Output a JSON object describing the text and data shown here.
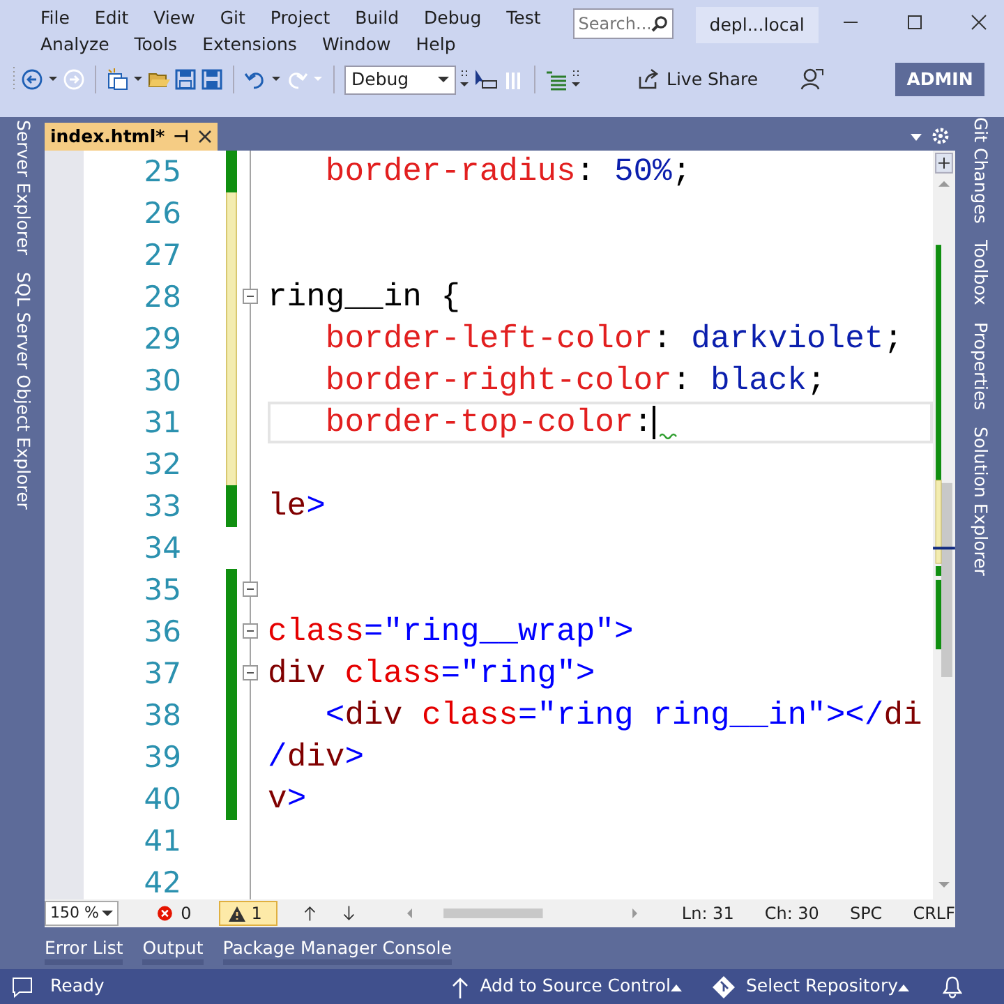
{
  "menu_rows": [
    [
      "File",
      "Edit",
      "View",
      "Git",
      "Project",
      "Build",
      "Debug",
      "Test"
    ],
    [
      "Analyze",
      "Tools",
      "Extensions",
      "Window",
      "Help"
    ]
  ],
  "search": {
    "placeholder": "Search..."
  },
  "solution_name": "depl...local",
  "toolbar": [
    {
      "kind": "back",
      "disabled": false
    },
    {
      "kind": "dropdown",
      "disabled": false
    },
    {
      "kind": "forward",
      "disabled": true
    },
    {
      "kind": "separator"
    },
    {
      "kind": "new",
      "disabled": false
    },
    {
      "kind": "dropdown",
      "disabled": false
    },
    {
      "kind": "open",
      "disabled": false
    },
    {
      "kind": "save",
      "disabled": false
    },
    {
      "kind": "save-all",
      "disabled": false
    },
    {
      "kind": "separator"
    },
    {
      "kind": "undo",
      "disabled": false
    },
    {
      "kind": "dropdown",
      "disabled": false
    },
    {
      "kind": "redo",
      "disabled": true
    },
    {
      "kind": "dropdown",
      "disabled": true
    },
    {
      "kind": "separator"
    },
    {
      "kind": "config"
    },
    {
      "kind": "overflow"
    },
    {
      "kind": "pointer",
      "disabled": false
    },
    {
      "kind": "columns",
      "disabled": true
    },
    {
      "kind": "separator"
    },
    {
      "kind": "indent",
      "disabled": false
    },
    {
      "kind": "overflow"
    }
  ],
  "configuration": "Debug",
  "live_share": "Live Share",
  "account": "ADMIN",
  "document_tabs": [
    {
      "label": "index.html*",
      "selected": true,
      "pin": "⊣"
    }
  ],
  "lines": [
    {
      "number": "25",
      "modified": true,
      "saved": true,
      "indented": true,
      "tokens": [
        {
          "kind": "property",
          "text": "border-radius"
        },
        {
          "kind": "plain",
          "text": ": "
        },
        {
          "kind": "value",
          "text": "50%"
        },
        {
          "kind": "plain",
          "text": ";"
        }
      ]
    },
    {
      "number": "26",
      "modified": true,
      "saved": false
    },
    {
      "number": "27",
      "modified": true,
      "saved": false
    },
    {
      "number": "28",
      "modified": true,
      "saved": false,
      "expanded": true,
      "tokens": [
        {
          "kind": "plain",
          "text": "ring__in {"
        }
      ]
    },
    {
      "number": "29",
      "modified": true,
      "saved": false,
      "indented": true,
      "tokens": [
        {
          "kind": "property",
          "text": "border-left-color"
        },
        {
          "kind": "plain",
          "text": ": "
        },
        {
          "kind": "value",
          "text": "darkviolet"
        },
        {
          "kind": "plain",
          "text": ";"
        }
      ]
    },
    {
      "number": "30",
      "modified": true,
      "saved": false,
      "indented": true,
      "tokens": [
        {
          "kind": "property",
          "text": "border-right-color"
        },
        {
          "kind": "plain",
          "text": ": "
        },
        {
          "kind": "value",
          "text": "black"
        },
        {
          "kind": "plain",
          "text": ";"
        }
      ]
    },
    {
      "number": "31",
      "modified": true,
      "saved": false,
      "indented": true,
      "current": true,
      "squiggle": true,
      "tokens": [
        {
          "kind": "property",
          "text": "border-top-color"
        },
        {
          "kind": "plain",
          "text": ":"
        }
      ]
    },
    {
      "number": "32",
      "modified": true,
      "saved": false
    },
    {
      "number": "33",
      "modified": true,
      "saved": true,
      "tokens": [
        {
          "kind": "tag",
          "text": "le"
        },
        {
          "kind": "punct",
          "text": ">"
        }
      ]
    },
    {
      "number": "34",
      "modified": false
    },
    {
      "number": "35",
      "modified": true,
      "saved": true,
      "expanded": true
    },
    {
      "number": "36",
      "modified": true,
      "saved": true,
      "expanded": true,
      "tokens": [
        {
          "kind": "attr",
          "text": "class"
        },
        {
          "kind": "punct",
          "text": "=\""
        },
        {
          "kind": "string",
          "text": "ring__wrap"
        },
        {
          "kind": "punct",
          "text": "\">"
        }
      ]
    },
    {
      "number": "37",
      "modified": true,
      "saved": true,
      "expanded": true,
      "tokens": [
        {
          "kind": "tag",
          "text": "div"
        },
        {
          "kind": "attr",
          "text": " class"
        },
        {
          "kind": "punct",
          "text": "=\""
        },
        {
          "kind": "string",
          "text": "ring"
        },
        {
          "kind": "punct",
          "text": "\">"
        }
      ]
    },
    {
      "number": "38",
      "modified": true,
      "saved": true,
      "indented": true,
      "tokens": [
        {
          "kind": "punct",
          "text": "<"
        },
        {
          "kind": "tag",
          "text": "div"
        },
        {
          "kind": "attr",
          "text": " class"
        },
        {
          "kind": "punct",
          "text": "=\""
        },
        {
          "kind": "string",
          "text": "ring ring__in"
        },
        {
          "kind": "punct",
          "text": "\"></"
        },
        {
          "kind": "tag",
          "text": "di"
        }
      ]
    },
    {
      "number": "39",
      "modified": true,
      "saved": true,
      "tokens": [
        {
          "kind": "punct",
          "text": "/"
        },
        {
          "kind": "tag",
          "text": "div"
        },
        {
          "kind": "punct",
          "text": ">"
        }
      ]
    },
    {
      "number": "40",
      "modified": true,
      "saved": true,
      "tokens": [
        {
          "kind": "tag",
          "text": "v"
        },
        {
          "kind": "punct",
          "text": ">"
        }
      ]
    },
    {
      "number": "41",
      "modified": false
    },
    {
      "number": "42",
      "modified": false
    }
  ],
  "editor_status": {
    "zoom": "150 %",
    "errors": "0",
    "warnings": "1",
    "line": "Ln: 31",
    "column": "Ch: 30",
    "whitespace": "SPC",
    "line_ending": "CRLF"
  },
  "tool_tabs": [
    "Error List",
    "Output",
    "Package Manager Console"
  ],
  "left_tabs": [
    "Server Explorer",
    "SQL Server Object Explorer"
  ],
  "right_tabs": [
    "Git Changes",
    "Toolbox",
    "Properties",
    "Solution Explorer"
  ],
  "status_bar": {
    "state": "Ready",
    "source_control": "Add to Source Control",
    "repository": "Select Repository"
  }
}
